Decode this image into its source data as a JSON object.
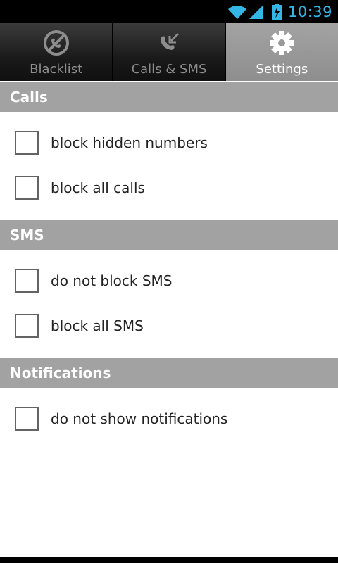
{
  "status_bar": {
    "time": "10:39",
    "icons": [
      "wifi-icon",
      "cell-signal-icon",
      "battery-charging-icon"
    ],
    "accent_color": "#33b5e5"
  },
  "tabs": [
    {
      "label": "Blacklist",
      "icon": "blocked-call-icon",
      "selected": false
    },
    {
      "label": "Calls & SMS",
      "icon": "incoming-call-icon",
      "selected": false
    },
    {
      "label": "Settings",
      "icon": "gear-icon",
      "selected": true
    }
  ],
  "sections": [
    {
      "title": "Calls",
      "items": [
        {
          "label": "block hidden numbers",
          "checked": false
        },
        {
          "label": "block all calls",
          "checked": false
        }
      ]
    },
    {
      "title": "SMS",
      "items": [
        {
          "label": "do not block SMS",
          "checked": false
        },
        {
          "label": "block all SMS",
          "checked": false
        }
      ]
    },
    {
      "title": "Notifications",
      "items": [
        {
          "label": "do not show notifications",
          "checked": false
        }
      ]
    }
  ],
  "colors": {
    "section_header_bg": "#a2a2a2",
    "selected_tab_bg": "#999999"
  }
}
